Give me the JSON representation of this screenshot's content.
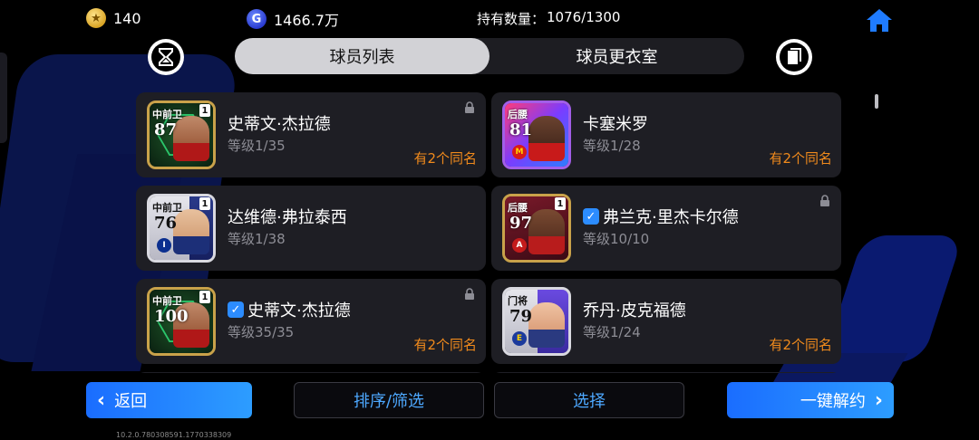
{
  "top": {
    "coins": "140",
    "gp": "1466.7万",
    "holdings_label": "持有数量：",
    "holdings_value": "1076/1300"
  },
  "tabs": [
    {
      "label": "球员列表",
      "active": true
    },
    {
      "label": "球员更衣室",
      "active": false
    }
  ],
  "players": [
    {
      "position": "中前卫",
      "rating": "87",
      "level_badge": "1",
      "name": "史蒂文·杰拉德",
      "checked": false,
      "level": "等级1/35",
      "duplicate": "有2个同名",
      "locked": true,
      "frame": "gold"
    },
    {
      "position": "后腰",
      "rating": "81",
      "level_badge": "",
      "name": "卡塞米罗",
      "checked": false,
      "level": "等级1/28",
      "duplicate": "有2个同名",
      "locked": false,
      "frame": "purple"
    },
    {
      "position": "中前卫",
      "rating": "76",
      "level_badge": "1",
      "name": "达维德·弗拉泰西",
      "checked": false,
      "level": "等级1/38",
      "duplicate": "",
      "locked": false,
      "frame": "white"
    },
    {
      "position": "后腰",
      "rating": "97",
      "level_badge": "1",
      "name": "弗兰克·里杰卡尔德",
      "checked": true,
      "level": "等级10/10",
      "duplicate": "",
      "locked": true,
      "frame": "gold"
    },
    {
      "position": "中前卫",
      "rating": "100",
      "level_badge": "1",
      "name": "史蒂文·杰拉德",
      "checked": true,
      "level": "等级35/35",
      "duplicate": "有2个同名",
      "locked": true,
      "frame": "gold"
    },
    {
      "position": "门将",
      "rating": "79",
      "level_badge": "",
      "name": "乔丹·皮克福德",
      "checked": false,
      "level": "等级1/24",
      "duplicate": "有2个同名",
      "locked": false,
      "frame": "white"
    }
  ],
  "bottom": {
    "back": "返回",
    "sort": "排序/筛选",
    "select": "选择",
    "release": "一键解约"
  },
  "version": "10.2.0.780308591.1770338309",
  "colors": {
    "accent_blue": "#2d8cff",
    "duplicate_orange": "#f08a1c",
    "card_bg": "#1e1e24"
  }
}
